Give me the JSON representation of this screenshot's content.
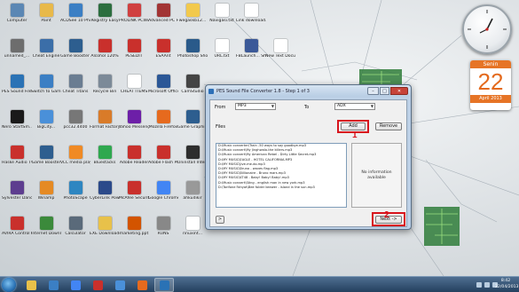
{
  "desktop_icons": [
    {
      "label": "Computer",
      "color": "#5b87b4"
    },
    {
      "label": "Paint",
      "color": "#e8b94a"
    },
    {
      "label": "ACDSee 10 Photo M...",
      "color": "#3b7fc4"
    },
    {
      "label": "Registry Easy",
      "color": "#2c6e3f"
    },
    {
      "label": "PROLINK PCWi300 UI",
      "color": "#d04040"
    },
    {
      "label": "Advanced PC Faster",
      "color": "#a23434"
    },
    {
      "label": "wegaskb12...",
      "color": "#f2c94c"
    },
    {
      "label": "Navigasi.txt",
      "color": "#ffffff"
    },
    {
      "label": "Link download.txt",
      "color": "#ffffff"
    },
    {
      "label": "unnamed_...",
      "color": "#6d6d6d"
    },
    {
      "label": "Cheat Engine",
      "color": "#3b6ea8"
    },
    {
      "label": "Game Booster 3",
      "color": "#2d5e8f"
    },
    {
      "label": "Alcohol 120%",
      "color": "#c9302c"
    },
    {
      "label": "PESEDIT",
      "color": "#c9302c"
    },
    {
      "label": "ESAAnt",
      "color": "#c9302c"
    },
    {
      "label": "Photoshop Shortcut",
      "color": "#2a5a8a"
    },
    {
      "label": "URL.txt",
      "color": "#ffffff"
    },
    {
      "label": "FBLaunch... Shortcut",
      "color": "#3b5998"
    },
    {
      "label": "New Text Document",
      "color": "#ffffff"
    },
    {
      "label": "PES Sound File Conv...",
      "color": "#2a72b5"
    },
    {
      "label": "Switch to Game...",
      "color": "#3b7fc4"
    },
    {
      "label": "Cheat Titans",
      "color": "#6a7d92"
    },
    {
      "label": "Recycle Bin",
      "color": "#7c8a98"
    },
    {
      "label": "CHEAT ITEMS",
      "color": "#ffffff"
    },
    {
      "label": "Microsoft Office W...",
      "color": "#2b5797"
    },
    {
      "label": "CamStudio",
      "color": "#444444"
    },
    {
      "label": "Nero StartSm...",
      "color": "#1a1a1a"
    },
    {
      "label": "BigCity...",
      "color": "#4a90d9"
    },
    {
      "label": "pcc32.4400",
      "color": "#777777"
    },
    {
      "label": "Format Factory",
      "color": "#d97b29"
    },
    {
      "label": "Yahoo Messenger",
      "color": "#6d1fa8"
    },
    {
      "label": "Mozilla Firefox",
      "color": "#e66a1e"
    },
    {
      "label": "Game Graphi...",
      "color": "#2d5e8f"
    },
    {
      "label": "Haske Audio TV",
      "color": "#c9302c"
    },
    {
      "label": "Game Booster",
      "color": "#2d5e8f"
    },
    {
      "label": "VLC media player",
      "color": "#f08a24"
    },
    {
      "label": "Bluestacks",
      "color": "#2fa84f"
    },
    {
      "label": "Adobe Reader",
      "color": "#c9302c"
    },
    {
      "label": "Adobe Flash Player",
      "color": "#c9302c"
    },
    {
      "label": "Uninstall Internet FIFA",
      "color": "#2d2d2d"
    },
    {
      "label": "Sylvester Dancing Call",
      "color": "#5d3d8f"
    },
    {
      "label": "Winamp",
      "color": "#e58a24"
    },
    {
      "label": "PhotoScape",
      "color": "#2e86c1"
    },
    {
      "label": "CyberLink PowerDVD",
      "color": "#2c4a8a"
    },
    {
      "label": "McAfee Security Sca...",
      "color": "#c9302c"
    },
    {
      "label": "Google Chrome",
      "color": "#4285f4"
    },
    {
      "label": "ahkudikir",
      "color": "#999999"
    },
    {
      "label": "iTunes",
      "color": "#4a90d9"
    },
    {
      "label": "AVIRA Control Cent...",
      "color": "#c9302c"
    },
    {
      "label": "Internet Download...",
      "color": "#3b8a3b"
    },
    {
      "label": "Calculator",
      "color": "#5a6a7a"
    },
    {
      "label": "EXE Downloads",
      "color": "#e8c14a"
    },
    {
      "label": "marketing.ppt",
      "color": "#d35400"
    },
    {
      "label": "RUNS",
      "color": "#888888"
    },
    {
      "label": "rinuxint...",
      "color": "#ffffff"
    }
  ],
  "gadgets": {
    "calendar": {
      "day": "Senin",
      "date": "22",
      "month": "April 2013"
    }
  },
  "window": {
    "title": "PES Sound File Converter 1.8 - Step 1 of 3",
    "from_label": "From",
    "from_value": "MP3",
    "to_label": "To",
    "to_value": "ADX",
    "files_label": "Files",
    "add_button": "Add",
    "remove_button": "Remove",
    "info_text": "No information available",
    "next_button": "Next ->",
    "small_button": ">",
    "files": [
      "D:\\Music converter\\Train -50 ways to say goodbye.mp3",
      "D:\\Music convert\\My Jinghwalo-the killers.mp3",
      "D:\\Music convert\\My American Rebel - Dirty Little Secret.mp3",
      "D:\\MY MUSIC\\EAGLE - HOTEL CALIFORNIA.MP3",
      "D:\\MY MUSIC\\Jive-me-do.mp3",
      "D:\\MY MUSIC\\Bruno - waves flag.mp3",
      "D:\\MY MUSIC\\Billionaire - Bruno mars.mp3",
      "D:\\MY MUSIC\\KT48 - Baby! Baby! Baby!.mp3",
      "D:\\Music convert\\Sting - english man in new york.mp3",
      "D:\\Tarifone Fahyat\\Bee folder keewer - island in the sun.mp3"
    ],
    "annotation_1": "1",
    "annotation_2": "2"
  },
  "taskbar": {
    "time": "8:42",
    "date": "22/04/2013",
    "apps": [
      {
        "name": "explorer",
        "color": "#e8c14a"
      },
      {
        "name": "media",
        "color": "#3b7fc4"
      },
      {
        "name": "chrome",
        "color": "#4285f4"
      },
      {
        "name": "pesedit",
        "color": "#c9302c"
      },
      {
        "name": "ie",
        "color": "#4a90d9"
      },
      {
        "name": "firefox",
        "color": "#e66a1e"
      },
      {
        "name": "active-app",
        "color": "#2a72b5"
      }
    ]
  }
}
